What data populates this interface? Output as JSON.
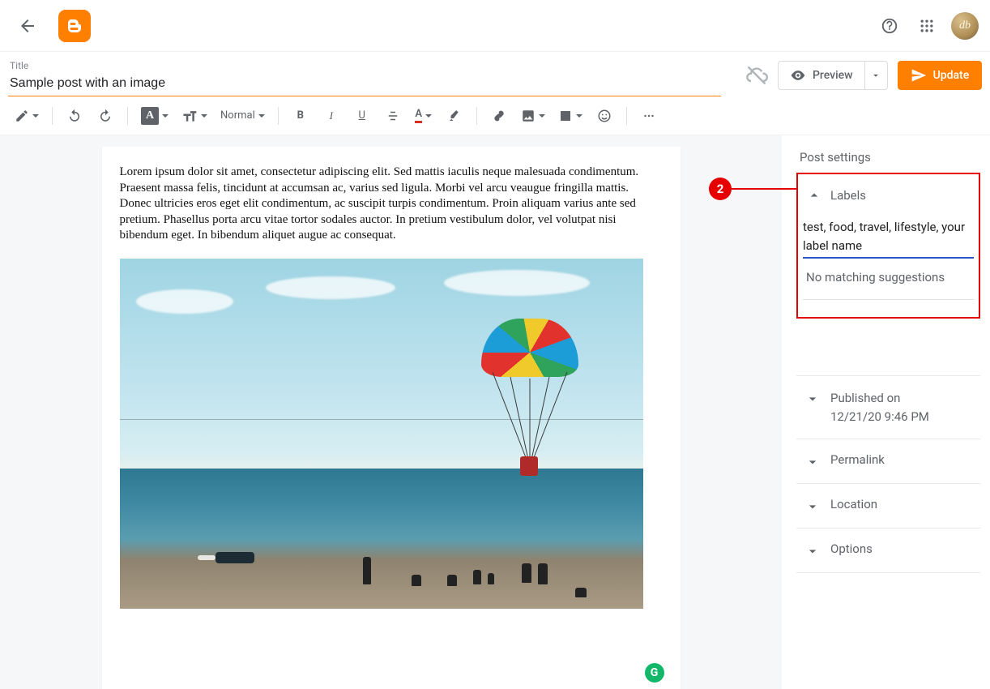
{
  "header": {
    "title_label": "Title",
    "title_value": "Sample post with an image",
    "preview_label": "Preview",
    "update_label": "Update"
  },
  "toolbar": {
    "format_label": "Normal"
  },
  "post": {
    "body": "Lorem ipsum dolor sit amet, consectetur adipiscing elit. Sed mattis iaculis neque malesuada condimentum. Praesent massa felis, tincidunt at accumsan ac, varius sed ligula. Morbi vel arcu veaugue fringilla mattis. Donec ultricies eros eget elit condimentum, ac suscipit turpis condimentum. Proin aliquam varius ante sed pretium. Phasellus porta arcu vitae tortor sodales auctor. In pretium vestibulum dolor, vel volutpat nisi bibendum eget. In bibendum aliquet augue ac consequat."
  },
  "sidebar": {
    "title": "Post settings",
    "labels_heading": "Labels",
    "labels_value": "test, food, travel, lifestyle, your label name",
    "labels_suggestion": "No matching suggestions",
    "callout_number": "2",
    "published_label": "Published on",
    "published_value": "12/21/20 9:46 PM",
    "permalink_label": "Permalink",
    "location_label": "Location",
    "options_label": "Options"
  },
  "avatar_initials": "db"
}
